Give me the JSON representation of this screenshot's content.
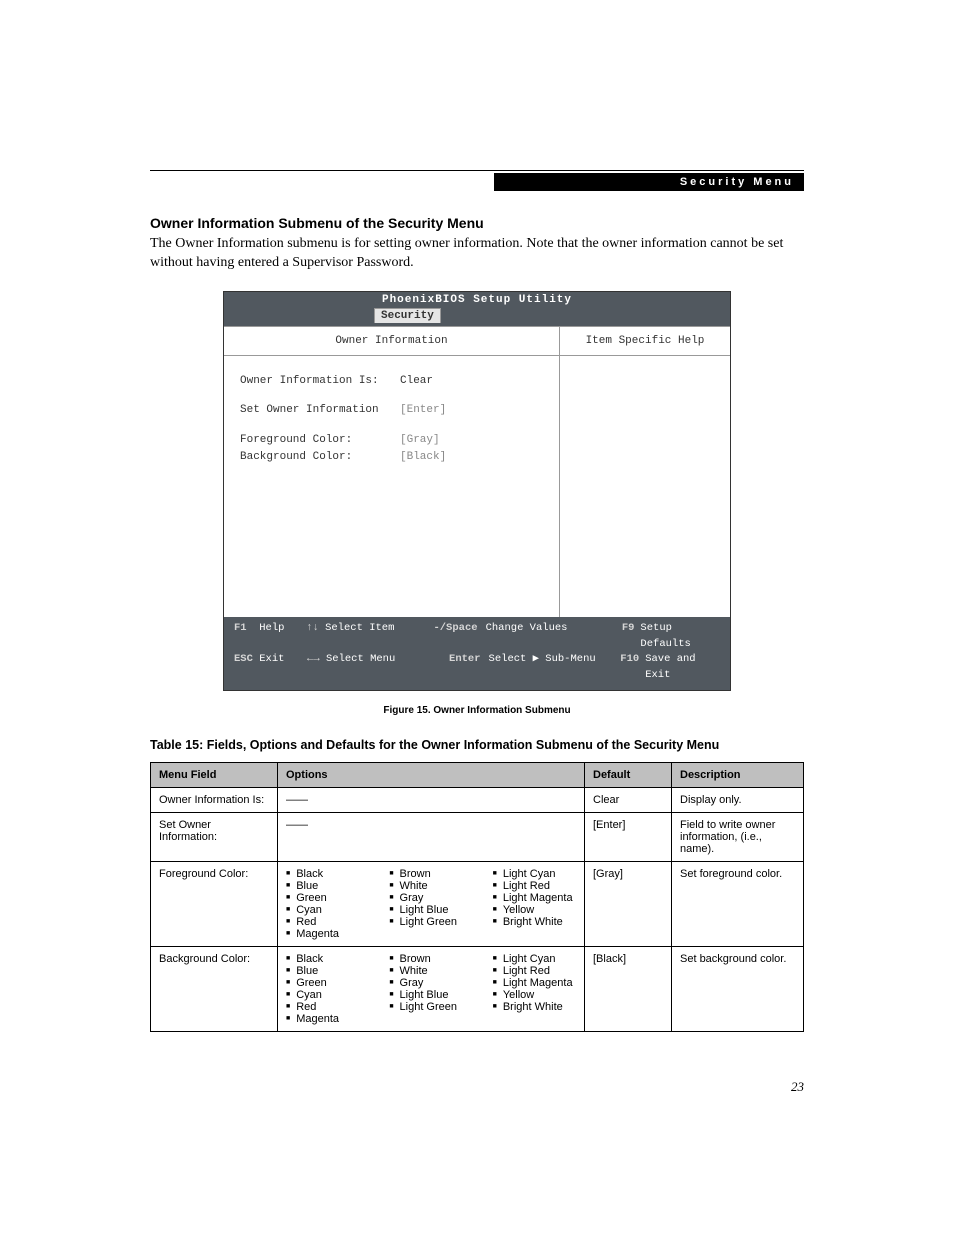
{
  "header": {
    "bar_label": "Security Menu"
  },
  "section": {
    "heading": "Owner Information Submenu of the Security Menu",
    "intro": "The Owner Information submenu is for setting owner information. Note that the owner information cannot be set without having entered a Supervisor Password."
  },
  "bios": {
    "title": "PhoenixBIOS Setup Utility",
    "tab": "Security",
    "left_title": "Owner Information",
    "right_title": "Item Specific Help",
    "fields": {
      "owner_info_is": {
        "label": "Owner Information Is:",
        "value": "Clear"
      },
      "set_owner_info": {
        "label": "Set Owner Information",
        "value": "[Enter]"
      },
      "fg_color": {
        "label": "Foreground Color:",
        "value": "[Gray]"
      },
      "bg_color": {
        "label": "Background Color:",
        "value": "[Black]"
      }
    },
    "footer": {
      "r1": {
        "k1": "F1",
        "t1": "Help",
        "k2": "↑↓",
        "t2": "Select Item",
        "k3": "-/Space",
        "t3": "Change Values",
        "k4": "F9",
        "t4": "Setup Defaults"
      },
      "r2": {
        "k1": "ESC",
        "t1": "Exit",
        "k2": "←→",
        "t2": "Select Menu",
        "k3": "Enter",
        "t3": "Select ▶ Sub-Menu",
        "k4": "F10",
        "t4": "Save and Exit"
      }
    }
  },
  "figure_caption": "Figure 15.   Owner Information Submenu",
  "table_title": "Table 15: Fields, Options and Defaults for the Owner Information Submenu of the Security Menu",
  "table": {
    "head": {
      "c1": "Menu Field",
      "c2": "Options",
      "c3": "Default",
      "c4": "Description"
    },
    "rows": [
      {
        "field": "Owner Information Is:",
        "options_dash": "——",
        "default": "Clear",
        "desc": "Display only."
      },
      {
        "field": "Set Owner Information:",
        "options_dash": "——",
        "default": "[Enter]",
        "desc": "Field to write owner information, (i.e., name)."
      },
      {
        "field": "Foreground Color:",
        "options_cols": [
          [
            "Black",
            "Blue",
            "Green",
            "Cyan",
            "Red",
            "Magenta"
          ],
          [
            "Brown",
            "White",
            "Gray",
            "Light Blue",
            "Light Green"
          ],
          [
            "Light Cyan",
            "Light Red",
            "Light Magenta",
            "Yellow",
            "Bright White"
          ]
        ],
        "default": "[Gray]",
        "desc": "Set foreground color."
      },
      {
        "field": "Background Color:",
        "options_cols": [
          [
            "Black",
            "Blue",
            "Green",
            "Cyan",
            "Red",
            "Magenta"
          ],
          [
            "Brown",
            "White",
            "Gray",
            "Light Blue",
            "Light Green"
          ],
          [
            "Light Cyan",
            "Light Red",
            "Light Magenta",
            "Yellow",
            "Bright White"
          ]
        ],
        "default": "[Black]",
        "desc": "Set background color."
      }
    ]
  },
  "page_number": "23"
}
